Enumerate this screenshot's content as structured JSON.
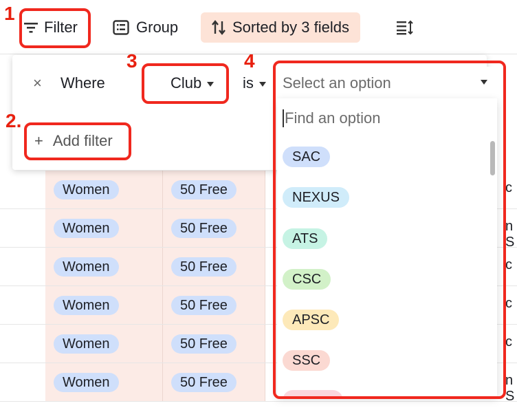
{
  "toolbar": {
    "filter_label": "Filter",
    "group_label": "Group",
    "sorted_label": "Sorted by 3 fields"
  },
  "filter_panel": {
    "remove_symbol": "×",
    "where_label": "Where",
    "field_value": "Club",
    "operator_value": "is",
    "value_placeholder": "Select an option",
    "add_filter_symbol": "+",
    "add_filter_label": "Add filter"
  },
  "dropdown": {
    "search_placeholder": "Find an option",
    "options": [
      {
        "label": "SAC",
        "color": "#cfdffb"
      },
      {
        "label": "NEXUS",
        "color": "#d0ecfa"
      },
      {
        "label": "ATS",
        "color": "#c6f3e4"
      },
      {
        "label": "CSC",
        "color": "#d2f1c8"
      },
      {
        "label": "APSC",
        "color": "#fde9b9"
      },
      {
        "label": "SSC",
        "color": "#fbd9d2"
      }
    ]
  },
  "table": {
    "rows": [
      {
        "gender": "Women",
        "event": "50 Free",
        "right": "c"
      },
      {
        "gender": "Women",
        "event": "50 Free",
        "right": "n S"
      },
      {
        "gender": "Women",
        "event": "50 Free",
        "right": "c"
      },
      {
        "gender": "Women",
        "event": "50 Free",
        "right": "c"
      },
      {
        "gender": "Women",
        "event": "50 Free",
        "right": "c"
      },
      {
        "gender": "Women",
        "event": "50 Free",
        "right": "n S"
      }
    ]
  },
  "annotations": {
    "n1": "1",
    "n2": "2.",
    "n3": "3",
    "n4": "4"
  },
  "colors": {
    "accent_red": "#f0281e",
    "sorted_bg": "#fde3d7",
    "row_tint": "#fcebe6",
    "pill_blue": "#cfdffb"
  }
}
